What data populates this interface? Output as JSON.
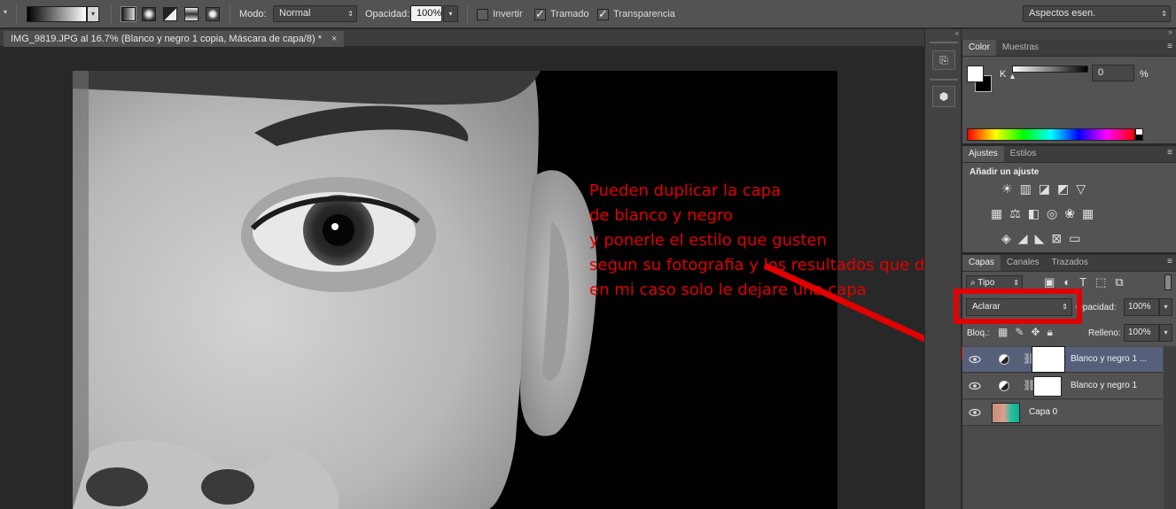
{
  "options_bar": {
    "mode_label": "Modo:",
    "mode_value": "Normal",
    "opacity_label": "Opacidad:",
    "opacity_value": "100%",
    "invert_label": "Invertir",
    "dither_label": "Tramado",
    "transparency_label": "Transparencia",
    "workspace_value": "Aspectos esen."
  },
  "document": {
    "tab_title": "IMG_9819.JPG al 16.7% (Blanco y negro 1 copia, Máscara de capa/8) *",
    "close_glyph": "×"
  },
  "annotation": {
    "text": "Pueden duplicar la capa\nde blanco y negro\ny ponerle el estilo que gusten\nsegun su fotografia y los resultados que deseen\nen mi caso solo le dejare una capa",
    "color": "#e10000"
  },
  "color_panel": {
    "tabs": [
      "Color",
      "Muestras"
    ],
    "channel_label": "K",
    "channel_value": "0",
    "unit": "%"
  },
  "adjustments_panel": {
    "tabs": [
      "Ajustes",
      "Estilos"
    ],
    "heading": "Añadir un ajuste"
  },
  "layers_panel": {
    "tabs": [
      "Capas",
      "Canales",
      "Trazados"
    ],
    "filter_value": "Tipo",
    "blend_mode": "Aclarar",
    "opacity_label": "Opacidad:",
    "opacity_value": "100%",
    "lock_label": "Bloq.:",
    "fill_label": "Relleno:",
    "fill_value": "100%",
    "layers": [
      {
        "name": "Blanco y negro 1 ...",
        "selected": true
      },
      {
        "name": "Blanco y negro 1",
        "selected": false
      },
      {
        "name": "Capa 0",
        "selected": false
      }
    ]
  },
  "highlight_color": "#e10000"
}
